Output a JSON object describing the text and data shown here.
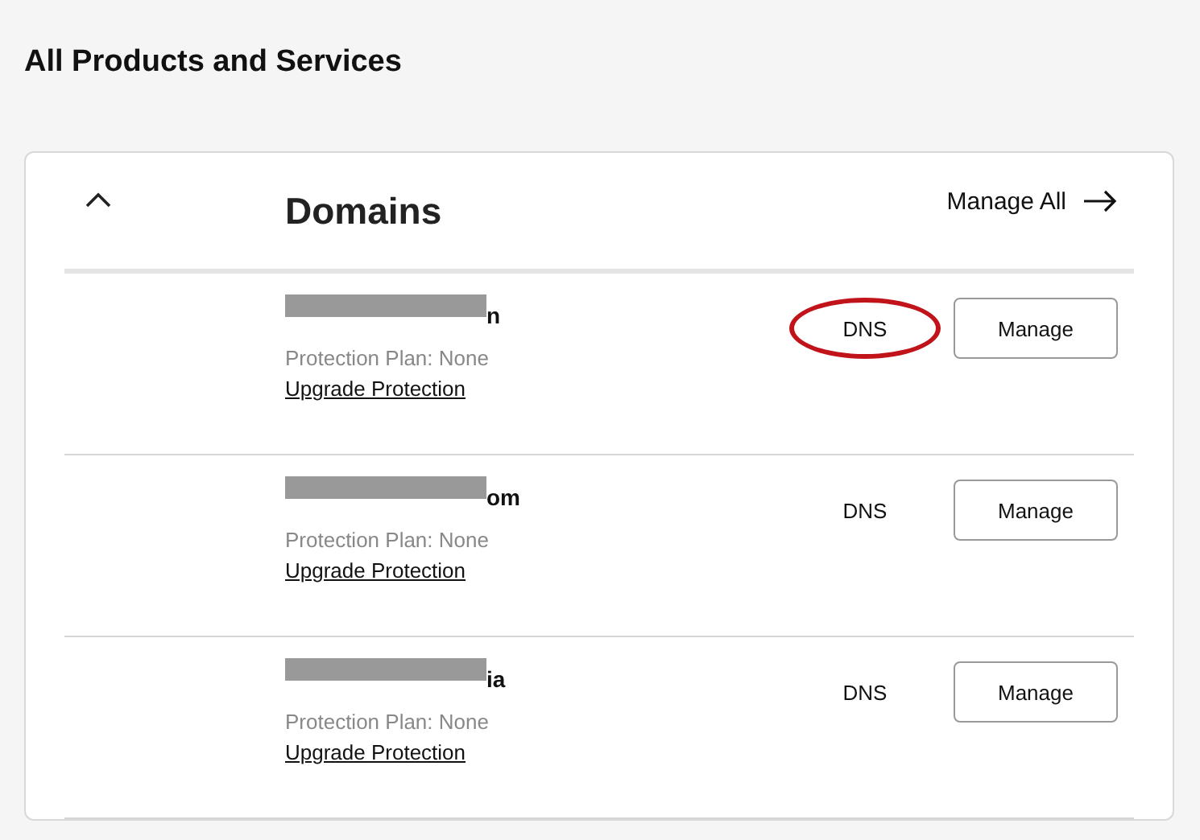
{
  "page_title": "All Products and Services",
  "section": {
    "title": "Domains",
    "expanded": true,
    "manage_all": "Manage All"
  },
  "domains": [
    {
      "name_tail": "n",
      "redacted": true,
      "plan": "Protection Plan: None",
      "upgrade": "Upgrade Protection",
      "dns": "DNS",
      "dns_circled": true,
      "manage": "Manage"
    },
    {
      "name_tail": "om",
      "redacted": true,
      "plan": "Protection Plan: None",
      "upgrade": "Upgrade Protection",
      "dns": "DNS",
      "dns_circled": false,
      "manage": "Manage"
    },
    {
      "name_tail": "ia",
      "redacted": true,
      "plan": "Protection Plan: None",
      "upgrade": "Upgrade Protection",
      "dns": "DNS",
      "dns_circled": false,
      "manage": "Manage"
    }
  ]
}
